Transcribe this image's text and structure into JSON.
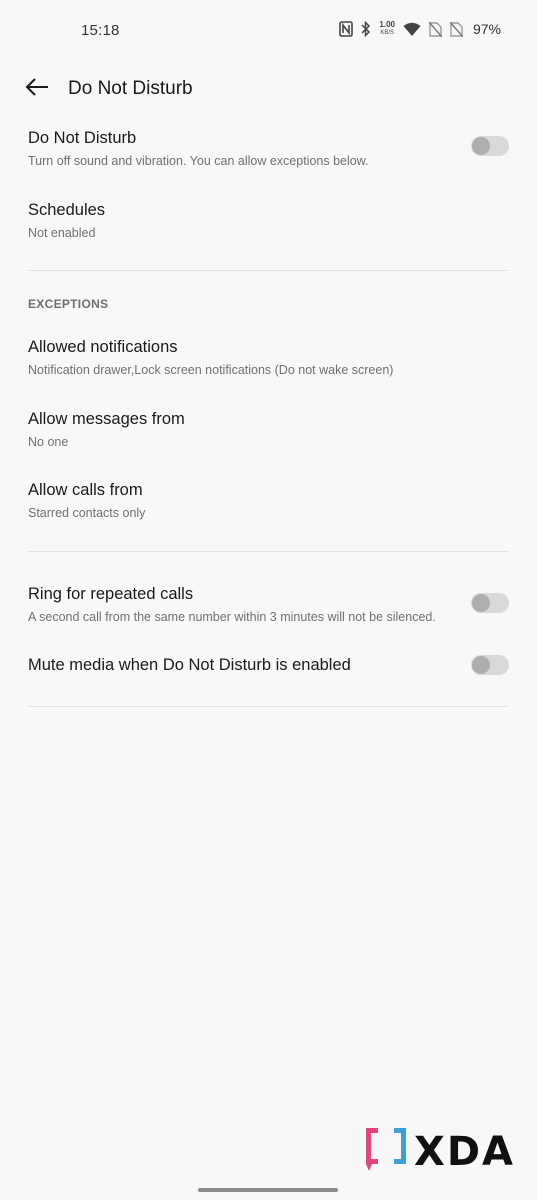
{
  "status_bar": {
    "time": "15:18",
    "speed_value": "1.00",
    "speed_unit": "KB/S",
    "battery": "97%",
    "icons": [
      "nfc-icon",
      "bluetooth-icon",
      "network-speed",
      "wifi-icon",
      "no-sim-icon",
      "no-sim-icon"
    ]
  },
  "app_bar": {
    "title": "Do Not Disturb",
    "back_icon": "arrow-back-icon"
  },
  "items": {
    "dnd": {
      "title": "Do Not Disturb",
      "summary": "Turn off sound and vibration. You can allow exceptions below.",
      "toggle_on": false
    },
    "schedules": {
      "title": "Schedules",
      "summary": "Not enabled"
    },
    "exceptions_header": "EXCEPTIONS",
    "allowed_notifications": {
      "title": "Allowed notifications",
      "summary": "Notification drawer,Lock screen notifications (Do not wake screen)"
    },
    "allow_messages": {
      "title": "Allow messages from",
      "summary": "No one"
    },
    "allow_calls": {
      "title": "Allow calls from",
      "summary": "Starred contacts only"
    },
    "repeated_calls": {
      "title": "Ring for repeated calls",
      "summary": "A second call from the same number within 3 minutes will not be silenced.",
      "toggle_on": false
    },
    "mute_media": {
      "title": "Mute media when Do Not Disturb is enabled",
      "toggle_on": false
    }
  },
  "watermark": {
    "text": "XDA"
  },
  "colors": {
    "background": "#f8f8f8",
    "toggle_track_off": "#d9d9d9",
    "toggle_knob_off": "#aeaeae",
    "watermark_pink": "#e0457b",
    "watermark_blue": "#3aa0d8"
  }
}
